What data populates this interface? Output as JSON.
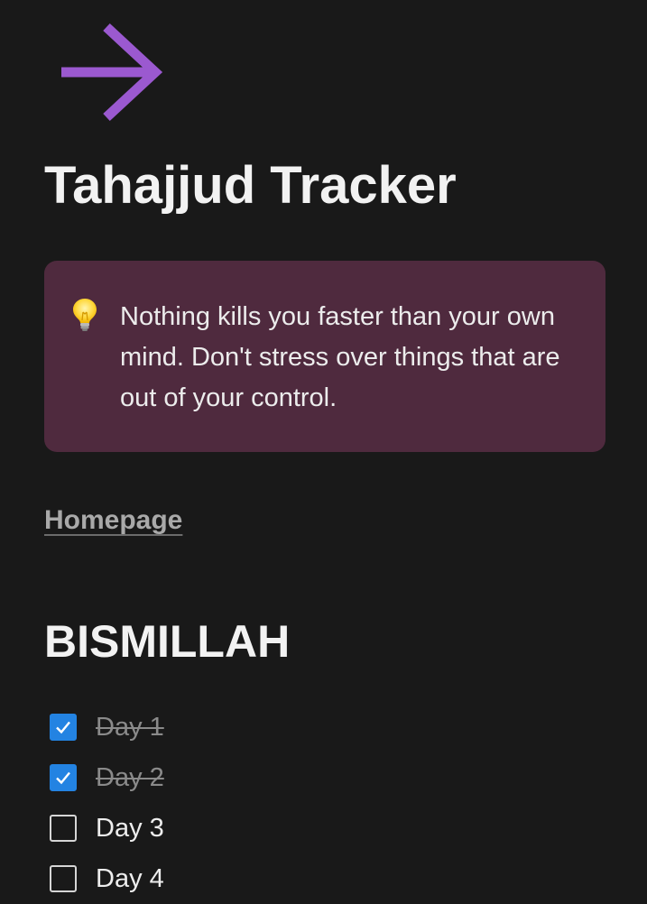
{
  "page": {
    "title": "Tahajjud Tracker",
    "icon": "arrow-right-icon",
    "icon_color": "#9b59d0"
  },
  "callout": {
    "icon": "light-bulb-icon",
    "text": "Nothing kills you faster than your own mind. Don't stress over things that are out of your control.",
    "background": "#4f2a3e"
  },
  "link": {
    "label": "Homepage"
  },
  "section": {
    "heading": "BISMILLAH"
  },
  "todos": [
    {
      "label": "Day 1",
      "checked": true
    },
    {
      "label": "Day 2",
      "checked": true
    },
    {
      "label": "Day 3",
      "checked": false
    },
    {
      "label": "Day 4",
      "checked": false
    }
  ],
  "colors": {
    "background": "#191919",
    "checkbox_checked": "#2383e2"
  }
}
